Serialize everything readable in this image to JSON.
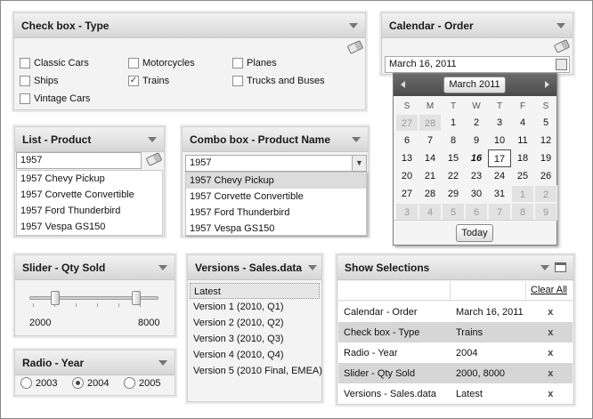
{
  "checkbox_type": {
    "title": "Check box - Type",
    "items": [
      {
        "label": "Classic Cars",
        "checked": false
      },
      {
        "label": "Motorcycles",
        "checked": false
      },
      {
        "label": "Planes",
        "checked": false
      },
      {
        "label": "Ships",
        "checked": false
      },
      {
        "label": "Trains",
        "checked": true
      },
      {
        "label": "Trucks and Buses",
        "checked": false
      },
      {
        "label": "Vintage Cars",
        "checked": false
      }
    ]
  },
  "calendar_order": {
    "title": "Calendar - Order",
    "value": "March 16, 2011",
    "month_label": "March 2011",
    "weekdays": [
      "S",
      "M",
      "T",
      "W",
      "T",
      "F",
      "S"
    ],
    "days": [
      "27",
      "28",
      "1",
      "2",
      "3",
      "4",
      "5",
      "6",
      "7",
      "8",
      "9",
      "10",
      "11",
      "12",
      "13",
      "14",
      "15",
      "16",
      "17",
      "18",
      "19",
      "20",
      "21",
      "22",
      "23",
      "24",
      "25",
      "26",
      "27",
      "28",
      "29",
      "30",
      "31",
      "1",
      "2",
      "3",
      "4",
      "5",
      "6",
      "7",
      "8",
      "9"
    ],
    "today_label": "Today"
  },
  "list_product": {
    "title": "List - Product",
    "search_value": "1957",
    "items": [
      "1957 Chevy Pickup",
      "1957 Corvette Convertible",
      "1957 Ford Thunderbird",
      "1957 Vespa GS150"
    ]
  },
  "combo_product_name": {
    "title": "Combo box - Product Name",
    "input_value": "1957",
    "items": [
      "1957 Chevy Pickup",
      "1957 Corvette Convertible",
      "1957 Ford Thunderbird",
      "1957 Vespa GS150"
    ]
  },
  "slider_qty_sold": {
    "title": "Slider - Qty Sold",
    "min_label": "2000",
    "max_label": "8000"
  },
  "radio_year": {
    "title": "Radio - Year",
    "options": [
      "2003",
      "2004",
      "2005"
    ],
    "selected": "2004"
  },
  "versions": {
    "title": "Versions - Sales.data",
    "items": [
      "Latest",
      "Version 1 (2010, Q1)",
      "Version 2 (2010, Q2)",
      "Version 3 (2010, Q3)",
      "Version 4 (2010, Q4)",
      "Version 5 (2010 Final, EMEA)"
    ]
  },
  "show_selections": {
    "title": "Show Selections",
    "clear_all_label": "Clear All",
    "rows": [
      {
        "name": "Calendar - Order",
        "value": "March 16, 2011"
      },
      {
        "name": "Check box - Type",
        "value": "Trains"
      },
      {
        "name": "Radio - Year",
        "value": "2004"
      },
      {
        "name": "Slider - Qty Sold",
        "value": "2000, 8000"
      },
      {
        "name": "Versions - Sales.data",
        "value": "Latest"
      }
    ],
    "remove_glyph": "x"
  },
  "colors": {
    "header_top": "#f2f2f2",
    "header_bottom": "#d6d6d6",
    "panel_bg": "#f3f3f3",
    "calendar_header": "#4a4a4a"
  }
}
